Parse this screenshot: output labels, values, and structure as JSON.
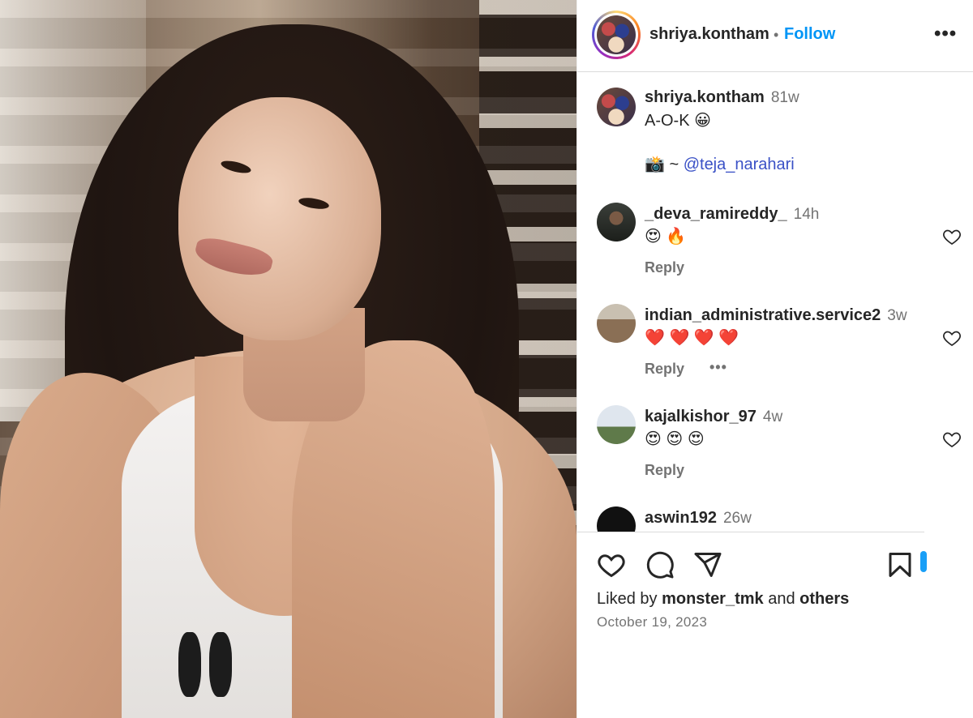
{
  "post": {
    "author": "shriya.kontham",
    "follow_label": "Follow",
    "separator": "•",
    "more_glyph": "•••"
  },
  "caption": {
    "username": "shriya.kontham",
    "time": "81w",
    "text": "A-O-K 😀",
    "credit_prefix": "📸 ~ ",
    "credit_mention": "@teja_narahari"
  },
  "comments": [
    {
      "username": "_deva_ramireddy_",
      "time": "14h",
      "text": "😍 🔥",
      "reply_label": "Reply",
      "avatar_icon": "user-avatar"
    },
    {
      "username": "indian_administrative.service2",
      "time": "3w",
      "text": "❤️ ❤️ ❤️ ❤️",
      "reply_label": "Reply",
      "more": "•••",
      "avatar_icon": "user-avatar"
    },
    {
      "username": "kajalkishor_97",
      "time": "4w",
      "text": "😍 😍 😍",
      "reply_label": "Reply",
      "avatar_icon": "user-avatar"
    },
    {
      "username": "aswin192",
      "time": "26w"
    }
  ],
  "actions": {
    "icons": [
      "heart-icon",
      "comment-icon",
      "share-icon",
      "bookmark-icon"
    ]
  },
  "likes": {
    "prefix": "Liked by ",
    "user": "monster_tmk",
    "middle": " and ",
    "others": "others"
  },
  "date": "October 19, 2023",
  "colors": {
    "follow": "#0095f6",
    "secondary_text": "#737373",
    "mention": "#3a51c6"
  }
}
